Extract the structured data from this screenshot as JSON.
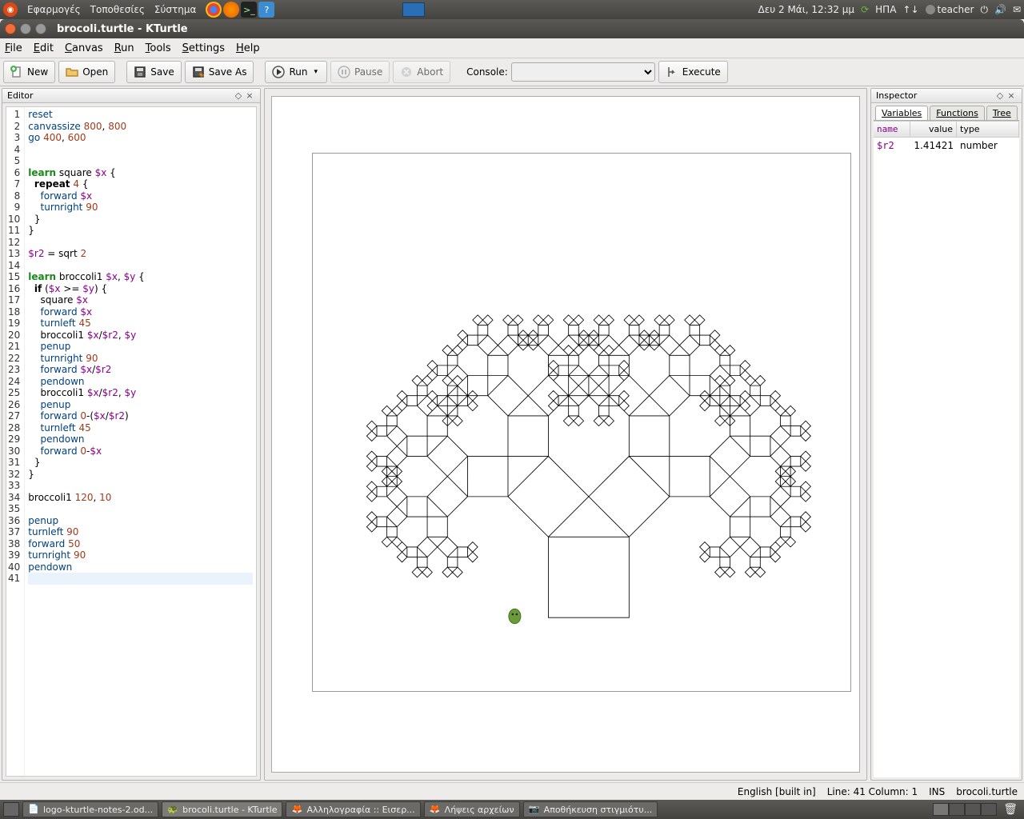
{
  "desktop_panel": {
    "menus": [
      "Εφαρμογές",
      "Τοποθεσίες",
      "Σύστημα"
    ],
    "clock": "Δευ  2 Μάι, 12:32 μμ",
    "keyboard": "ΗΠΑ",
    "user": "teacher"
  },
  "window": {
    "title": "brocoli.turtle - KTurtle"
  },
  "menubar": [
    "File",
    "Edit",
    "Canvas",
    "Run",
    "Tools",
    "Settings",
    "Help"
  ],
  "toolbar": {
    "new": "New",
    "open": "Open",
    "save": "Save",
    "saveas": "Save As",
    "run": "Run",
    "pause": "Pause",
    "abort": "Abort",
    "console_label": "Console:",
    "execute": "Execute"
  },
  "editor": {
    "title": "Editor",
    "lines": [
      {
        "n": 1,
        "tokens": [
          [
            "cmd",
            "reset"
          ]
        ]
      },
      {
        "n": 2,
        "tokens": [
          [
            "cmd",
            "canvassize "
          ],
          [
            "num",
            "800"
          ],
          [
            "sym",
            ", "
          ],
          [
            "num",
            "800"
          ]
        ]
      },
      {
        "n": 3,
        "tokens": [
          [
            "cmd",
            "go "
          ],
          [
            "num",
            "400"
          ],
          [
            "sym",
            ", "
          ],
          [
            "num",
            "600"
          ]
        ]
      },
      {
        "n": 4,
        "tokens": []
      },
      {
        "n": 5,
        "tokens": []
      },
      {
        "n": 6,
        "tokens": [
          [
            "learn",
            "learn"
          ],
          [
            "sym",
            " square "
          ],
          [
            "var",
            "$x"
          ],
          [
            "sym",
            " {"
          ]
        ]
      },
      {
        "n": 7,
        "tokens": [
          [
            "sym",
            "  "
          ],
          [
            "flow",
            "repeat"
          ],
          [
            "sym",
            " "
          ],
          [
            "num",
            "4"
          ],
          [
            "sym",
            " {"
          ]
        ]
      },
      {
        "n": 8,
        "tokens": [
          [
            "sym",
            "    "
          ],
          [
            "cmd",
            "forward "
          ],
          [
            "var",
            "$x"
          ]
        ]
      },
      {
        "n": 9,
        "tokens": [
          [
            "sym",
            "    "
          ],
          [
            "cmd",
            "turnright "
          ],
          [
            "num",
            "90"
          ]
        ]
      },
      {
        "n": 10,
        "tokens": [
          [
            "sym",
            "  }"
          ]
        ]
      },
      {
        "n": 11,
        "tokens": [
          [
            "sym",
            "}"
          ]
        ]
      },
      {
        "n": 12,
        "tokens": []
      },
      {
        "n": 13,
        "tokens": [
          [
            "var",
            "$r2"
          ],
          [
            "sym",
            " = sqrt "
          ],
          [
            "num",
            "2"
          ]
        ]
      },
      {
        "n": 14,
        "tokens": []
      },
      {
        "n": 15,
        "tokens": [
          [
            "learn",
            "learn"
          ],
          [
            "sym",
            " broccoli1 "
          ],
          [
            "var",
            "$x"
          ],
          [
            "sym",
            ", "
          ],
          [
            "var",
            "$y"
          ],
          [
            "sym",
            " {"
          ]
        ]
      },
      {
        "n": 16,
        "tokens": [
          [
            "sym",
            "  "
          ],
          [
            "flow",
            "if"
          ],
          [
            "sym",
            " ("
          ],
          [
            "var",
            "$x"
          ],
          [
            "sym",
            " >= "
          ],
          [
            "var",
            "$y"
          ],
          [
            "sym",
            ") {"
          ]
        ]
      },
      {
        "n": 17,
        "tokens": [
          [
            "sym",
            "    square "
          ],
          [
            "var",
            "$x"
          ]
        ]
      },
      {
        "n": 18,
        "tokens": [
          [
            "sym",
            "    "
          ],
          [
            "cmd",
            "forward "
          ],
          [
            "var",
            "$x"
          ]
        ]
      },
      {
        "n": 19,
        "tokens": [
          [
            "sym",
            "    "
          ],
          [
            "cmd",
            "turnleft "
          ],
          [
            "num",
            "45"
          ]
        ]
      },
      {
        "n": 20,
        "tokens": [
          [
            "sym",
            "    broccoli1 "
          ],
          [
            "var",
            "$x"
          ],
          [
            "sym",
            "/"
          ],
          [
            "var",
            "$r2"
          ],
          [
            "sym",
            ", "
          ],
          [
            "var",
            "$y"
          ]
        ]
      },
      {
        "n": 21,
        "tokens": [
          [
            "sym",
            "    "
          ],
          [
            "cmd",
            "penup"
          ]
        ]
      },
      {
        "n": 22,
        "tokens": [
          [
            "sym",
            "    "
          ],
          [
            "cmd",
            "turnright "
          ],
          [
            "num",
            "90"
          ]
        ]
      },
      {
        "n": 23,
        "tokens": [
          [
            "sym",
            "    "
          ],
          [
            "cmd",
            "forward "
          ],
          [
            "var",
            "$x"
          ],
          [
            "sym",
            "/"
          ],
          [
            "var",
            "$r2"
          ]
        ]
      },
      {
        "n": 24,
        "tokens": [
          [
            "sym",
            "    "
          ],
          [
            "cmd",
            "pendown"
          ]
        ]
      },
      {
        "n": 25,
        "tokens": [
          [
            "sym",
            "    broccoli1 "
          ],
          [
            "var",
            "$x"
          ],
          [
            "sym",
            "/"
          ],
          [
            "var",
            "$r2"
          ],
          [
            "sym",
            ", "
          ],
          [
            "var",
            "$y"
          ]
        ]
      },
      {
        "n": 26,
        "tokens": [
          [
            "sym",
            "    "
          ],
          [
            "cmd",
            "penup"
          ]
        ]
      },
      {
        "n": 27,
        "tokens": [
          [
            "sym",
            "    "
          ],
          [
            "cmd",
            "forward "
          ],
          [
            "num",
            "0"
          ],
          [
            "sym",
            "-("
          ],
          [
            "var",
            "$x"
          ],
          [
            "sym",
            "/"
          ],
          [
            "var",
            "$r2"
          ],
          [
            "sym",
            ")"
          ]
        ]
      },
      {
        "n": 28,
        "tokens": [
          [
            "sym",
            "    "
          ],
          [
            "cmd",
            "turnleft "
          ],
          [
            "num",
            "45"
          ]
        ]
      },
      {
        "n": 29,
        "tokens": [
          [
            "sym",
            "    "
          ],
          [
            "cmd",
            "pendown"
          ]
        ]
      },
      {
        "n": 30,
        "tokens": [
          [
            "sym",
            "    "
          ],
          [
            "cmd",
            "forward "
          ],
          [
            "num",
            "0"
          ],
          [
            "sym",
            "-"
          ],
          [
            "var",
            "$x"
          ]
        ]
      },
      {
        "n": 31,
        "tokens": [
          [
            "sym",
            "  }"
          ]
        ]
      },
      {
        "n": 32,
        "tokens": [
          [
            "sym",
            "}"
          ]
        ]
      },
      {
        "n": 33,
        "tokens": []
      },
      {
        "n": 34,
        "tokens": [
          [
            "sym",
            "broccoli1 "
          ],
          [
            "num",
            "120"
          ],
          [
            "sym",
            ", "
          ],
          [
            "num",
            "10"
          ]
        ]
      },
      {
        "n": 35,
        "tokens": []
      },
      {
        "n": 36,
        "tokens": [
          [
            "cmd",
            "penup"
          ]
        ]
      },
      {
        "n": 37,
        "tokens": [
          [
            "cmd",
            "turnleft "
          ],
          [
            "num",
            "90"
          ]
        ]
      },
      {
        "n": 38,
        "tokens": [
          [
            "cmd",
            "forward "
          ],
          [
            "num",
            "50"
          ]
        ]
      },
      {
        "n": 39,
        "tokens": [
          [
            "cmd",
            "turnright "
          ],
          [
            "num",
            "90"
          ]
        ]
      },
      {
        "n": 40,
        "tokens": [
          [
            "cmd",
            "pendown"
          ]
        ]
      },
      {
        "n": 41,
        "current": true,
        "tokens": []
      }
    ]
  },
  "inspector": {
    "title": "Inspector",
    "tabs": [
      "Variables",
      "Functions",
      "Tree"
    ],
    "active_tab": 0,
    "columns": [
      "name",
      "value",
      "type"
    ],
    "rows": [
      {
        "name": "$r2",
        "value": "1.41421",
        "type": "number"
      }
    ]
  },
  "statusbar": {
    "lang": "English [built in]",
    "pos": "Line: 41 Column: 1",
    "mode": "INS",
    "file": "brocoli.turtle"
  },
  "taskbar": {
    "items": [
      {
        "icon": "doc",
        "label": "logo-kturtle-notes-2.od..."
      },
      {
        "icon": "turtle",
        "label": "brocoli.turtle - KTurtle",
        "active": true
      },
      {
        "icon": "ff",
        "label": "Αλληλογραφία :: Εισερ..."
      },
      {
        "icon": "ff",
        "label": "Λήψεις αρχείων"
      },
      {
        "icon": "cam",
        "label": "Αποθήκευση στιγμιότυ..."
      }
    ]
  }
}
